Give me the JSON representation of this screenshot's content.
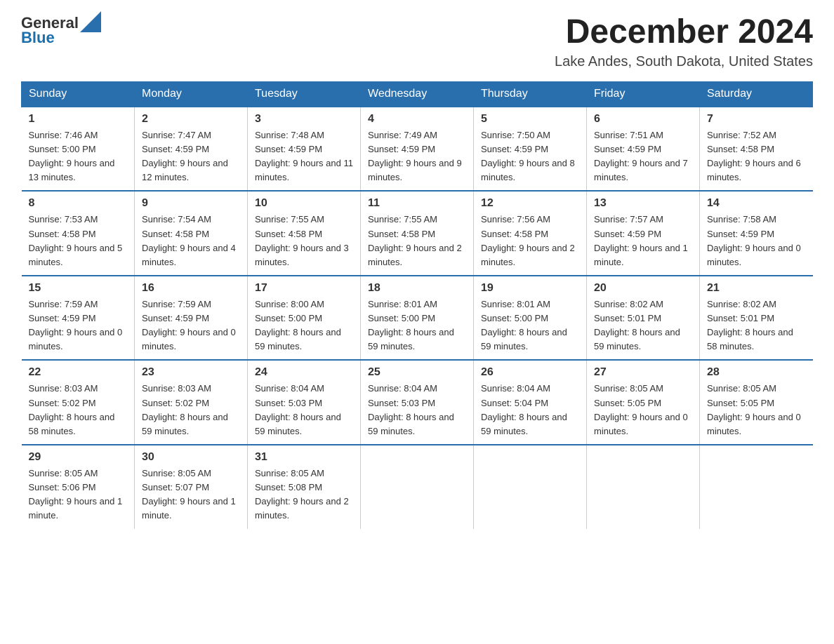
{
  "logo": {
    "general": "General",
    "blue": "Blue"
  },
  "title": "December 2024",
  "location": "Lake Andes, South Dakota, United States",
  "headers": [
    "Sunday",
    "Monday",
    "Tuesday",
    "Wednesday",
    "Thursday",
    "Friday",
    "Saturday"
  ],
  "weeks": [
    [
      {
        "day": "1",
        "sunrise": "7:46 AM",
        "sunset": "5:00 PM",
        "daylight": "9 hours and 13 minutes."
      },
      {
        "day": "2",
        "sunrise": "7:47 AM",
        "sunset": "4:59 PM",
        "daylight": "9 hours and 12 minutes."
      },
      {
        "day": "3",
        "sunrise": "7:48 AM",
        "sunset": "4:59 PM",
        "daylight": "9 hours and 11 minutes."
      },
      {
        "day": "4",
        "sunrise": "7:49 AM",
        "sunset": "4:59 PM",
        "daylight": "9 hours and 9 minutes."
      },
      {
        "day": "5",
        "sunrise": "7:50 AM",
        "sunset": "4:59 PM",
        "daylight": "9 hours and 8 minutes."
      },
      {
        "day": "6",
        "sunrise": "7:51 AM",
        "sunset": "4:59 PM",
        "daylight": "9 hours and 7 minutes."
      },
      {
        "day": "7",
        "sunrise": "7:52 AM",
        "sunset": "4:58 PM",
        "daylight": "9 hours and 6 minutes."
      }
    ],
    [
      {
        "day": "8",
        "sunrise": "7:53 AM",
        "sunset": "4:58 PM",
        "daylight": "9 hours and 5 minutes."
      },
      {
        "day": "9",
        "sunrise": "7:54 AM",
        "sunset": "4:58 PM",
        "daylight": "9 hours and 4 minutes."
      },
      {
        "day": "10",
        "sunrise": "7:55 AM",
        "sunset": "4:58 PM",
        "daylight": "9 hours and 3 minutes."
      },
      {
        "day": "11",
        "sunrise": "7:55 AM",
        "sunset": "4:58 PM",
        "daylight": "9 hours and 2 minutes."
      },
      {
        "day": "12",
        "sunrise": "7:56 AM",
        "sunset": "4:58 PM",
        "daylight": "9 hours and 2 minutes."
      },
      {
        "day": "13",
        "sunrise": "7:57 AM",
        "sunset": "4:59 PM",
        "daylight": "9 hours and 1 minute."
      },
      {
        "day": "14",
        "sunrise": "7:58 AM",
        "sunset": "4:59 PM",
        "daylight": "9 hours and 0 minutes."
      }
    ],
    [
      {
        "day": "15",
        "sunrise": "7:59 AM",
        "sunset": "4:59 PM",
        "daylight": "9 hours and 0 minutes."
      },
      {
        "day": "16",
        "sunrise": "7:59 AM",
        "sunset": "4:59 PM",
        "daylight": "9 hours and 0 minutes."
      },
      {
        "day": "17",
        "sunrise": "8:00 AM",
        "sunset": "5:00 PM",
        "daylight": "8 hours and 59 minutes."
      },
      {
        "day": "18",
        "sunrise": "8:01 AM",
        "sunset": "5:00 PM",
        "daylight": "8 hours and 59 minutes."
      },
      {
        "day": "19",
        "sunrise": "8:01 AM",
        "sunset": "5:00 PM",
        "daylight": "8 hours and 59 minutes."
      },
      {
        "day": "20",
        "sunrise": "8:02 AM",
        "sunset": "5:01 PM",
        "daylight": "8 hours and 59 minutes."
      },
      {
        "day": "21",
        "sunrise": "8:02 AM",
        "sunset": "5:01 PM",
        "daylight": "8 hours and 58 minutes."
      }
    ],
    [
      {
        "day": "22",
        "sunrise": "8:03 AM",
        "sunset": "5:02 PM",
        "daylight": "8 hours and 58 minutes."
      },
      {
        "day": "23",
        "sunrise": "8:03 AM",
        "sunset": "5:02 PM",
        "daylight": "8 hours and 59 minutes."
      },
      {
        "day": "24",
        "sunrise": "8:04 AM",
        "sunset": "5:03 PM",
        "daylight": "8 hours and 59 minutes."
      },
      {
        "day": "25",
        "sunrise": "8:04 AM",
        "sunset": "5:03 PM",
        "daylight": "8 hours and 59 minutes."
      },
      {
        "day": "26",
        "sunrise": "8:04 AM",
        "sunset": "5:04 PM",
        "daylight": "8 hours and 59 minutes."
      },
      {
        "day": "27",
        "sunrise": "8:05 AM",
        "sunset": "5:05 PM",
        "daylight": "9 hours and 0 minutes."
      },
      {
        "day": "28",
        "sunrise": "8:05 AM",
        "sunset": "5:05 PM",
        "daylight": "9 hours and 0 minutes."
      }
    ],
    [
      {
        "day": "29",
        "sunrise": "8:05 AM",
        "sunset": "5:06 PM",
        "daylight": "9 hours and 1 minute."
      },
      {
        "day": "30",
        "sunrise": "8:05 AM",
        "sunset": "5:07 PM",
        "daylight": "9 hours and 1 minute."
      },
      {
        "day": "31",
        "sunrise": "8:05 AM",
        "sunset": "5:08 PM",
        "daylight": "9 hours and 2 minutes."
      },
      null,
      null,
      null,
      null
    ]
  ],
  "labels": {
    "sunrise": "Sunrise:",
    "sunset": "Sunset:",
    "daylight": "Daylight:"
  }
}
